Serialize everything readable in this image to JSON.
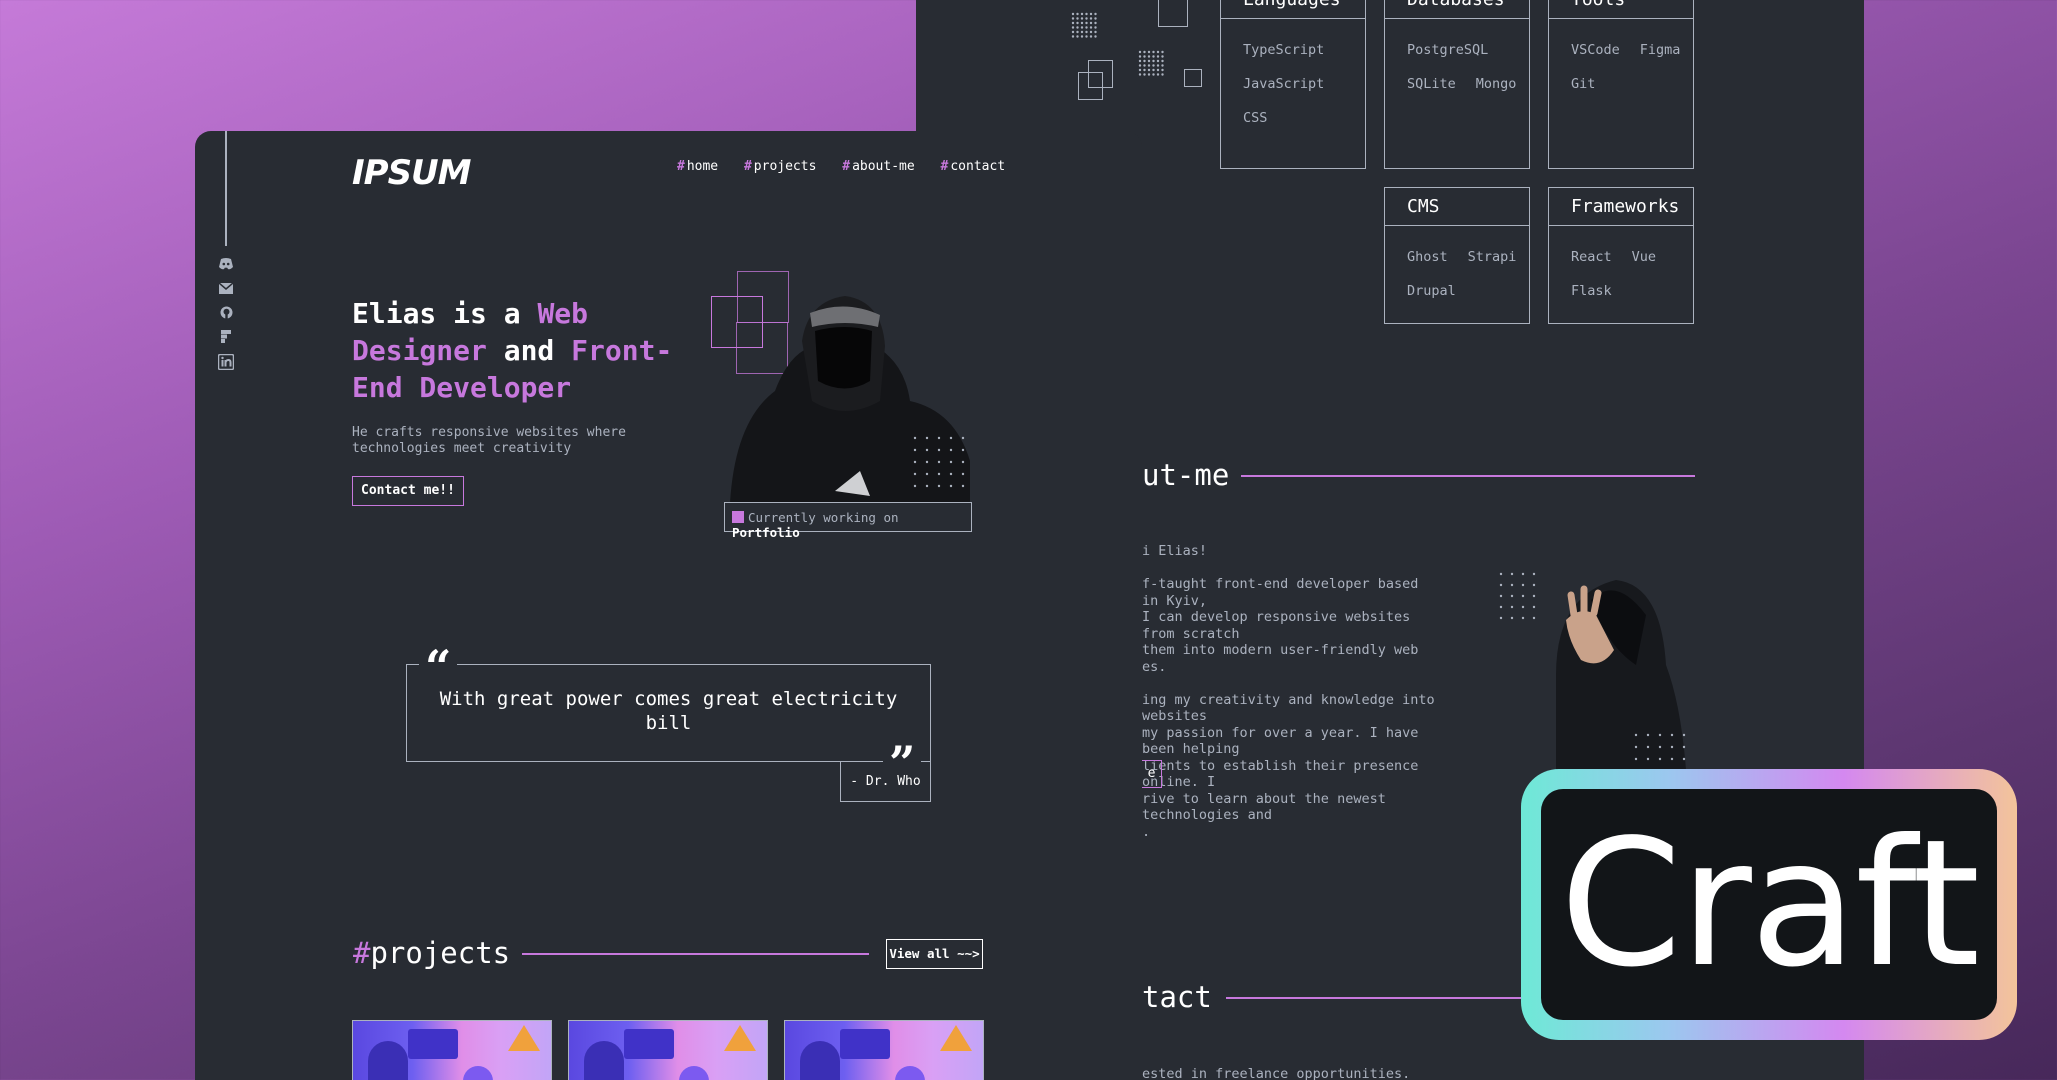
{
  "back": {
    "skills_top": [
      {
        "title": "Languages",
        "items": [
          [
            "TypeScript"
          ],
          [
            "JavaScript"
          ],
          [
            "CSS"
          ]
        ]
      },
      {
        "title": "Databases",
        "items": [
          [
            "PostgreSQL"
          ],
          [
            "SQLite",
            "Mongo"
          ]
        ]
      },
      {
        "title": "Tools",
        "items": [
          [
            "VSCode",
            "Figma"
          ],
          [
            "Git"
          ]
        ]
      }
    ],
    "skills_bottom": [
      {
        "title": "CMS",
        "items": [
          [
            "Ghost",
            "Strapi"
          ],
          [
            "Drupal"
          ]
        ]
      },
      {
        "title": "Frameworks",
        "items": [
          [
            "React",
            "Vue"
          ],
          [
            "Flask"
          ]
        ]
      }
    ],
    "about_title": "ut-me",
    "about_lines": [
      "i Elias!",
      "",
      "f-taught front-end developer based in Kyiv,",
      "I can develop responsive websites from scratch",
      " them into modern user-friendly web",
      "es.",
      "",
      "ing my creativity and knowledge into websites",
      "my passion for over a year. I have been helping",
      "lients to establish their presence online. I",
      "rive to learn about the newest technologies and",
      "."
    ],
    "about_button": "e",
    "contact_title": "tact",
    "contact_text": "ested in freelance opportunities. However, if"
  },
  "front": {
    "logo": "IPSUM",
    "nav": [
      {
        "hash": "#",
        "label": "home"
      },
      {
        "hash": "#",
        "label": "projects"
      },
      {
        "hash": "#",
        "label": "about-me"
      },
      {
        "hash": "#",
        "label": "contact"
      }
    ],
    "hero": {
      "t1": "Elias is a ",
      "t2": "Web Designer",
      "t3": " and ",
      "t4": "Front-End Developer",
      "subtitle": "He crafts responsive websites where technologies meet creativity",
      "button": "Contact me!!",
      "status_prefix": "Currently working on ",
      "status_project": "Portfolio"
    },
    "quote": {
      "text": "With great power comes great electricity bill",
      "author": "- Dr. Who",
      "open_mark": "“",
      "close_mark": "”"
    },
    "projects": {
      "hash": "#",
      "title": "projects",
      "view_all": "View all ~~>"
    },
    "social_icons": [
      "discord-icon",
      "email-icon",
      "github-icon",
      "figma-icon",
      "linkedin-icon"
    ]
  },
  "badge": {
    "text": "Craft"
  },
  "colors": {
    "accent": "#c778dd",
    "panel": "#282c33",
    "text": "#abb2bf"
  }
}
